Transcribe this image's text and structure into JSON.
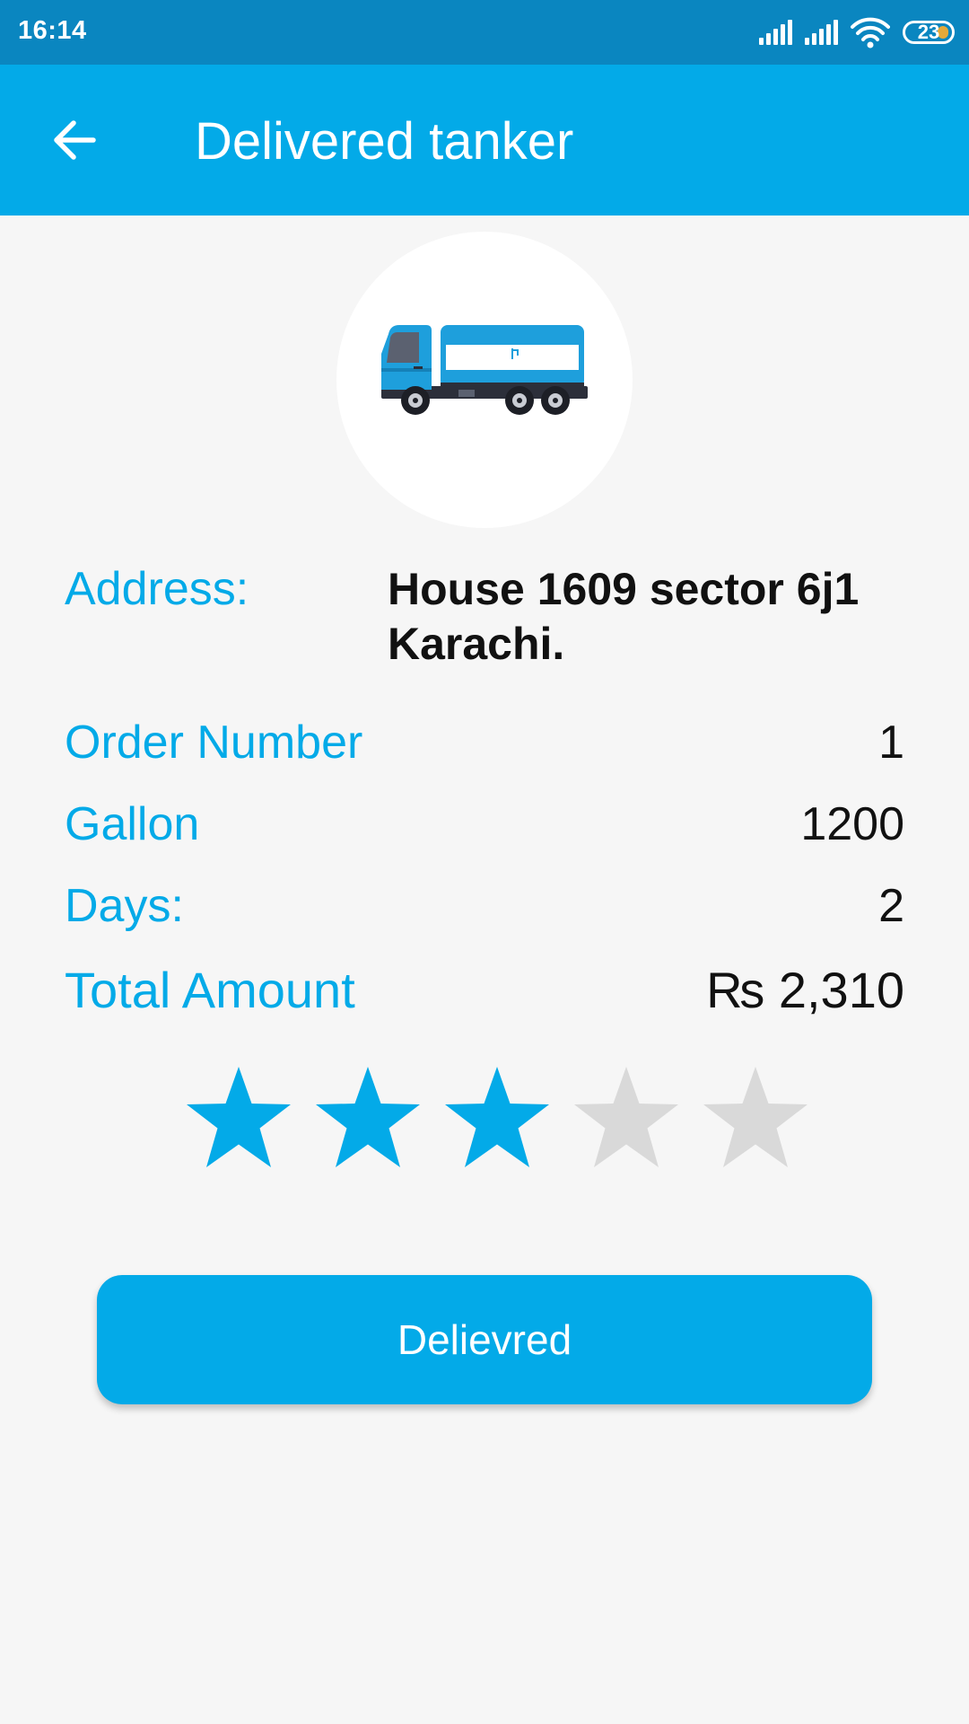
{
  "status_bar": {
    "time": "16:14",
    "battery": "23"
  },
  "app_bar": {
    "title": "Delivered tanker",
    "back_icon": "arrow-left-icon"
  },
  "avatar": {
    "icon": "water-tanker-truck-icon"
  },
  "details": {
    "address_label": "Address:",
    "address_value": "House 1609 sector 6j1 Karachi.",
    "order_number_label": "Order Number",
    "order_number_value": "1",
    "gallon_label": "Gallon",
    "gallon_value": "1200",
    "days_label": "Days:",
    "days_value": "2",
    "total_amount_label": "Total Amount",
    "total_amount_value": "₨ 2,310"
  },
  "rating": {
    "value": 3,
    "max": 5,
    "filled_color": "#03aae8",
    "empty_color": "#d9d9d9"
  },
  "colors": {
    "primary": "#03aae8",
    "status_bar": "#0a86c0"
  },
  "action": {
    "button_label": "Delievred"
  }
}
